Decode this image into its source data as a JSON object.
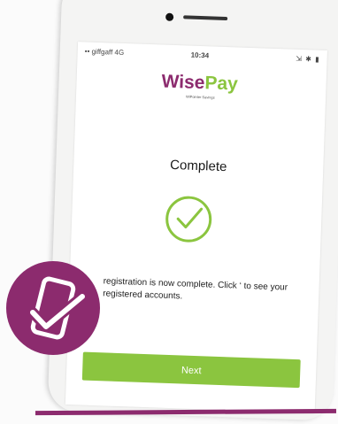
{
  "status_bar": {
    "carrier": "•• giffgaff 4G",
    "time": "10:34",
    "icons": "⇲ ✱ ▮"
  },
  "logo": {
    "text_main": "Wise",
    "text_tail": "Pay",
    "tagline": "WiPointer Savings"
  },
  "page": {
    "title": "Complete"
  },
  "message": "registration is now complete. Click ‘ to see your registered accounts.",
  "next_button": {
    "label": "Next"
  },
  "colors": {
    "brand_purple": "#8c2b6e",
    "brand_green": "#8bc53f"
  },
  "icons": [
    "check-circle-icon",
    "phone-check-badge-icon"
  ]
}
